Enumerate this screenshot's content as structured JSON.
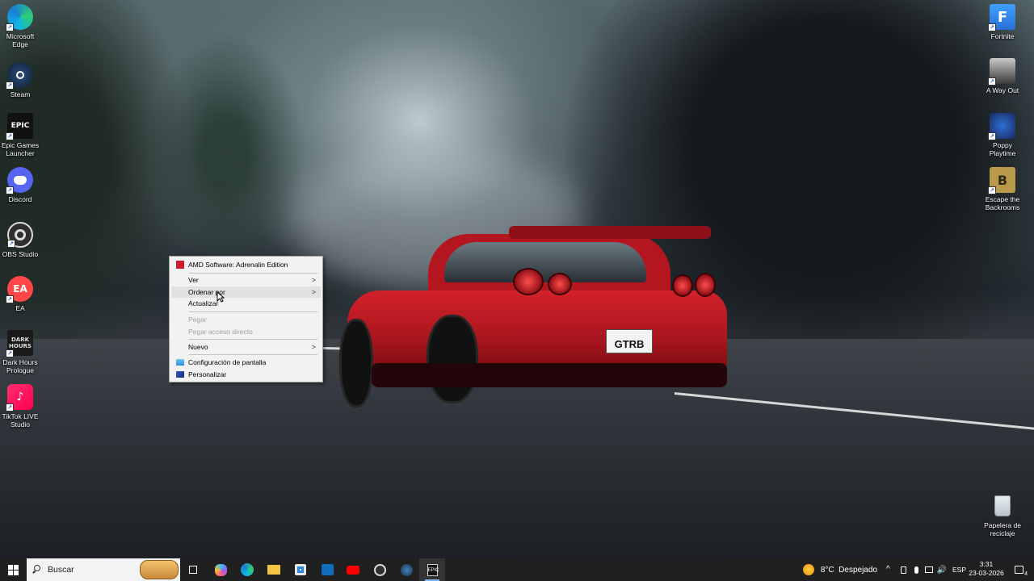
{
  "desktop_left": [
    {
      "label": "Microsoft Edge",
      "icon": "edge-icon"
    },
    {
      "label": "Steam",
      "icon": "steam-icon"
    },
    {
      "label": "Epic Games Launcher",
      "icon": "epic-games-icon",
      "glyph": "EPIC\nGAMES"
    },
    {
      "label": "Discord",
      "icon": "discord-icon"
    },
    {
      "label": "OBS Studio",
      "icon": "obs-icon"
    },
    {
      "label": "EA",
      "icon": "ea-icon",
      "glyph": "EA"
    },
    {
      "label": "Dark Hours Prologue",
      "icon": "dark-hours-icon",
      "glyph": "DARK\nHOURS"
    },
    {
      "label": "TikTok LIVE Studio",
      "icon": "tiktok-icon"
    }
  ],
  "desktop_right": [
    {
      "label": "Fortnite",
      "icon": "fortnite-icon",
      "glyph": "F"
    },
    {
      "label": "A Way Out",
      "icon": "a-way-out-icon"
    },
    {
      "label": "Poppy Playtime",
      "icon": "poppy-playtime-icon"
    },
    {
      "label": "Escape the Backrooms",
      "icon": "escape-backrooms-icon"
    },
    {
      "label": "Papelera de reciclaje",
      "icon": "recycle-bin-icon"
    }
  ],
  "wallpaper": {
    "plate": "GTRB"
  },
  "context_menu": {
    "amd": "AMD Software: Adrenalin Edition",
    "ver": "Ver",
    "ordenar": "Ordenar por",
    "actualizar": "Actualizar",
    "pegar": "Pegar",
    "pegar_acceso": "Pegar acceso directo",
    "nuevo": "Nuevo",
    "config_pantalla": "Configuración de pantalla",
    "personalizar": "Personalizar"
  },
  "taskbar": {
    "search_placeholder": "Buscar",
    "weather": "8°C  Despejado",
    "language": "ESP",
    "time": "3:31",
    "date": "23-03-2026",
    "notifications": "4"
  },
  "colors": {
    "taskbar": "#202020",
    "menu_bg": "#f2f2f2",
    "menu_hover": "#e1e1e1",
    "car_red": "#c81e26"
  }
}
